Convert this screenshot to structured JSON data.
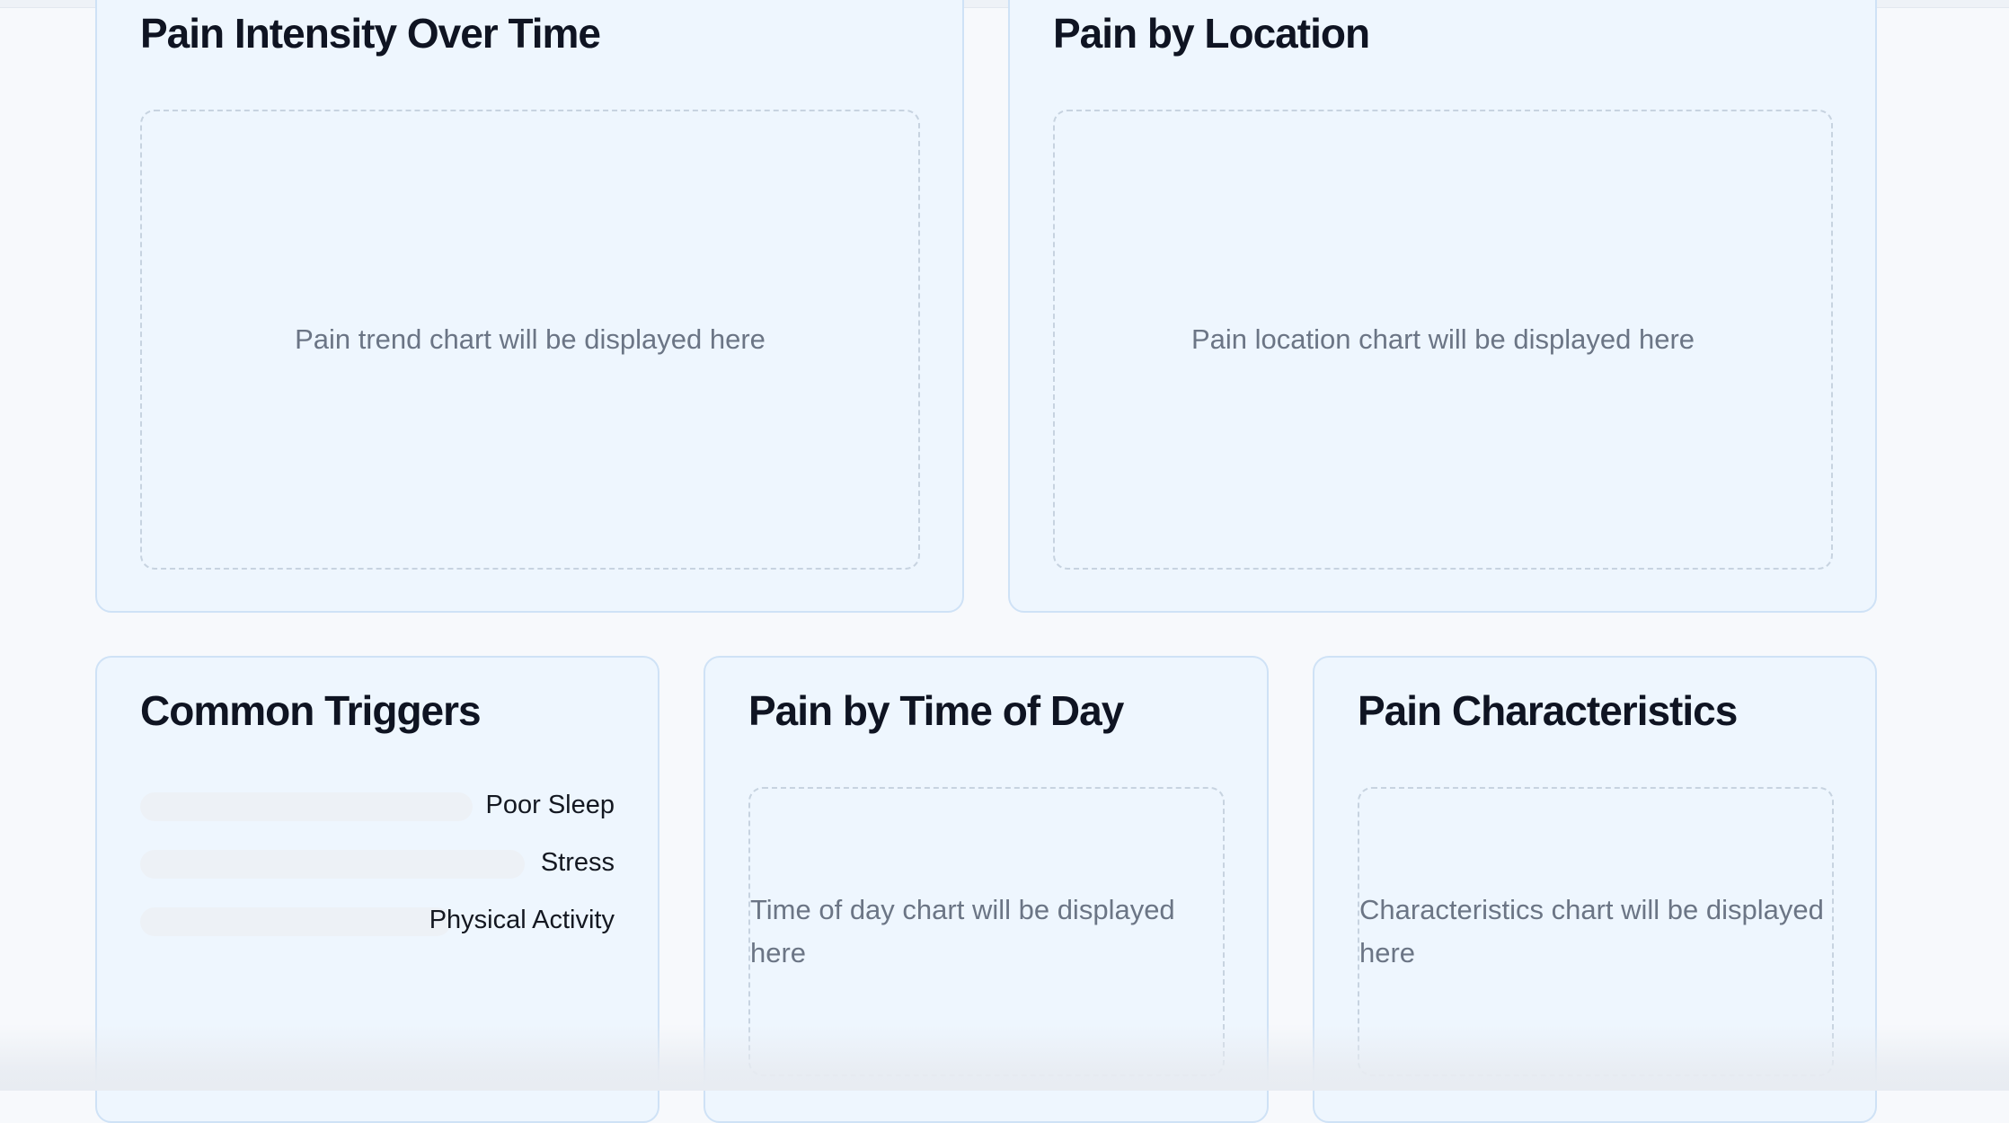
{
  "cards": {
    "pain_intensity": {
      "title": "Pain Intensity Over Time",
      "placeholder": "Pain trend chart will be displayed here"
    },
    "pain_location": {
      "title": "Pain by Location",
      "placeholder": "Pain location chart will be displayed here"
    },
    "common_triggers": {
      "title": "Common Triggers",
      "items": [
        {
          "label": "Poor Sleep"
        },
        {
          "label": "Stress"
        },
        {
          "label": "Physical Activity"
        }
      ]
    },
    "time_of_day": {
      "title": "Pain by Time of Day",
      "placeholder": "Time of day chart will be displayed here"
    },
    "characteristics": {
      "title": "Pain Characteristics",
      "placeholder": "Characteristics chart will be displayed here"
    }
  },
  "colors": {
    "card_background": "#eef6fe",
    "card_border": "#cfe2f6",
    "title_text": "#0f1422",
    "placeholder_text": "#6b7585"
  }
}
